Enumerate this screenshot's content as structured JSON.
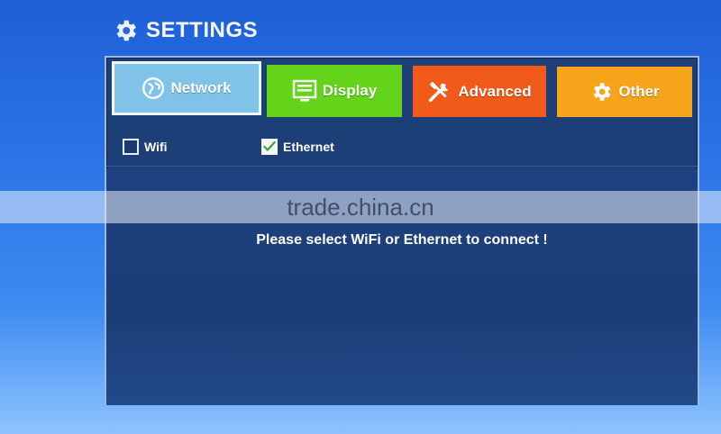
{
  "header": {
    "title": "SETTINGS",
    "icon": "gear-icon"
  },
  "tabs": [
    {
      "id": "network",
      "label": "Network",
      "icon": "globe-icon",
      "color": "#7fc4e8",
      "selected": true
    },
    {
      "id": "display",
      "label": "Display",
      "icon": "display-icon",
      "color": "#64d41b",
      "selected": false
    },
    {
      "id": "advanced",
      "label": "Advanced",
      "icon": "tools-icon",
      "color": "#f25a1a",
      "selected": false
    },
    {
      "id": "other",
      "label": "Other",
      "icon": "gear-icon",
      "color": "#f6a51a",
      "selected": false
    }
  ],
  "options": {
    "wifi": {
      "label": "Wifi",
      "checked": false
    },
    "ethernet": {
      "label": "Ethernet",
      "checked": true
    }
  },
  "message": "Please select WiFi or Ethernet to connect !",
  "watermark": "trade.china.cn"
}
